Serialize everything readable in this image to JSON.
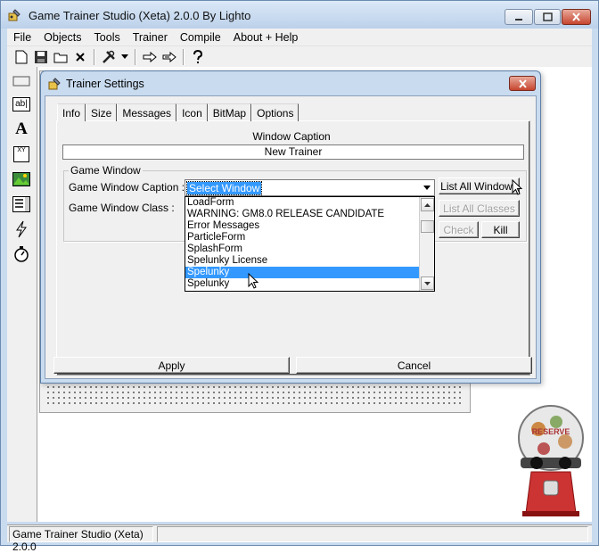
{
  "app": {
    "title": "Game Trainer Studio (Xeta) 2.0.0 By Lighto",
    "icon": "trainer-app-icon"
  },
  "menu": [
    "File",
    "Objects",
    "Tools",
    "Trainer",
    "Compile",
    "About + Help"
  ],
  "toolbar": {
    "icons": [
      "new-file-icon",
      "save-icon",
      "open-folder-icon",
      "close-x-icon",
      "tools-icon",
      "dropdown-arrow-icon",
      "arrow-right-icon",
      "double-arrow-right-icon",
      "help-question-icon"
    ]
  },
  "left_toolbox": {
    "icons": [
      "button-tool-icon",
      "textbox-tool-icon",
      "label-tool-icon",
      "checkbox-tool-icon",
      "image-tool-icon",
      "list-tool-icon",
      "hotkey-lightning-icon",
      "timer-stopwatch-icon"
    ],
    "textbox_glyph": "ab|",
    "label_glyph": "A",
    "checkbox_glyph": "XY"
  },
  "dialog": {
    "title": "Trainer Settings",
    "tabs": [
      "Info",
      "Size",
      "Messages",
      "Icon",
      "BitMap",
      "Options"
    ],
    "active_tab": "Info",
    "window_caption_label": "Window Caption",
    "window_caption_value": "New Trainer",
    "group_title": "Game Window",
    "game_window_caption_label": "Game Window Caption :",
    "game_window_class_label": "Game Window Class :",
    "combo_value": "Select Window",
    "dropdown_items": [
      "LoadForm",
      "WARNING: GM8.0 RELEASE CANDIDATE",
      "Error Messages",
      "ParticleForm",
      "SplashForm",
      "Spelunky License",
      "Spelunky",
      "Spelunky"
    ],
    "dropdown_selected_index": 6,
    "buttons": {
      "list_all_windows": "List All Windows",
      "list_all_classes": "List All Classes",
      "check": "Check",
      "kill": "Kill",
      "apply": "Apply",
      "cancel": "Cancel"
    }
  },
  "status": {
    "text": "Game Trainer Studio (Xeta) 2.0.0"
  },
  "decor": {
    "gumball_text": "RESERVE"
  },
  "colors": {
    "selection": "#3399ff",
    "title_bg": "#c9dbef",
    "close_red": "#c6452e"
  }
}
